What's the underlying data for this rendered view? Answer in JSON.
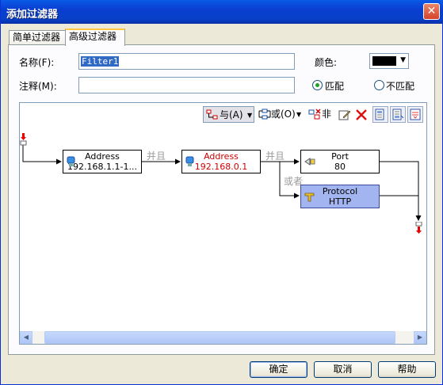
{
  "window": {
    "title": "添加过滤器",
    "close_glyph": "✕"
  },
  "tabs": [
    {
      "label": "简单过滤器",
      "active": false
    },
    {
      "label": "高级过滤器",
      "active": true
    }
  ],
  "form": {
    "name_label": "名称(F):",
    "name_value": "Filter1",
    "comment_label": "注释(M):",
    "comment_value": "",
    "color_label": "颜色:",
    "color_value": "#000000",
    "match_label": "匹配",
    "nomatch_label": "不匹配",
    "match_selected": true
  },
  "toolbar": {
    "and_label": "与(A)",
    "or_label": "或(O)",
    "not_label": "非",
    "icons": [
      "and-icon",
      "dropdown-arrow",
      "or-icon",
      "dropdown-arrow",
      "not-icon",
      "edit-icon",
      "delete-icon",
      "move-up-icon",
      "move-down-icon",
      "collapse-icon"
    ]
  },
  "diagram": {
    "nodes": [
      {
        "title": "Address",
        "value": "192.168.1.1-1...",
        "red": false,
        "selected": false,
        "icon": "address-icon"
      },
      {
        "title": "Address",
        "value": "192.168.0.1",
        "red": true,
        "selected": false,
        "icon": "address-icon"
      },
      {
        "title": "Port",
        "value": "80",
        "red": false,
        "selected": false,
        "icon": "port-icon"
      },
      {
        "title": "Protocol",
        "value": "HTTP",
        "red": false,
        "selected": true,
        "icon": "protocol-icon"
      }
    ],
    "and_label_1": "并且",
    "and_label_2": "并且",
    "or_label": "或者"
  },
  "buttons": {
    "ok": "确定",
    "cancel": "取消",
    "help": "帮助"
  }
}
